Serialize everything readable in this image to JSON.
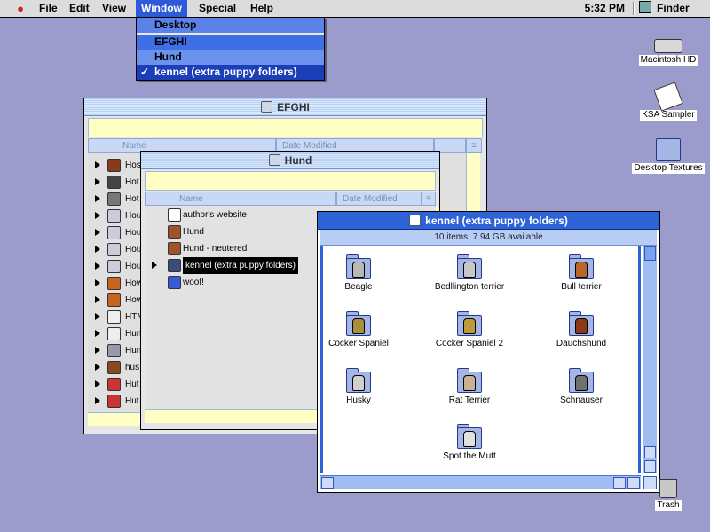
{
  "menubar": {
    "apple": "",
    "items": [
      "File",
      "Edit",
      "View",
      "Window",
      "Special",
      "Help"
    ],
    "clock": "5:32 PM",
    "app_name": "Finder"
  },
  "window_menu": {
    "items": [
      {
        "label": "Desktop",
        "checked": false
      },
      {
        "label": "EFGHI",
        "checked": false
      },
      {
        "label": "Hund",
        "checked": false
      },
      {
        "label": "kennel (extra puppy folders)",
        "checked": true
      }
    ]
  },
  "windows": {
    "efghi": {
      "title": "EFGHI",
      "col_name": "Name",
      "col_date": "Date Modified",
      "rows": [
        "Hos",
        "Hot",
        "Hot",
        "Hou",
        "Hou",
        "Hou",
        "Hou",
        "How",
        "How",
        "HTM",
        "Hun",
        "Hun",
        "hus",
        "Hut",
        "Hut"
      ]
    },
    "hund": {
      "title": "Hund",
      "col_name": "Name",
      "col_date": "Date Modified",
      "rows": [
        {
          "label": "author's website",
          "expandable": false
        },
        {
          "label": "Hund",
          "expandable": false
        },
        {
          "label": "Hund - neutered",
          "expandable": false
        },
        {
          "label": "kennel (extra puppy folders)",
          "expandable": true,
          "selected": true
        },
        {
          "label": "woof!",
          "expandable": false
        }
      ]
    },
    "kennel": {
      "title": "kennel (extra puppy folders)",
      "status": "10 items, 7.94 GB available",
      "items": [
        {
          "label": "Beagle",
          "dog_color": "#b8b8b8"
        },
        {
          "label": "Bedllington terrier",
          "dog_color": "#c8c8c8"
        },
        {
          "label": "Bull terrier",
          "dog_color": "#b8682a"
        },
        {
          "label": "Cocker Spaniel",
          "dog_color": "#a8903a"
        },
        {
          "label": "Cocker Spaniel 2",
          "dog_color": "#c09a38"
        },
        {
          "label": "Dauchshund",
          "dog_color": "#8a3a1a"
        },
        {
          "label": "Husky",
          "dog_color": "#d0d0d0"
        },
        {
          "label": "Rat Terrier",
          "dog_color": "#c8b090"
        },
        {
          "label": "Schnauser",
          "dog_color": "#707070"
        },
        {
          "label": "Spot the Mutt",
          "dog_color": "#e0e0e0"
        }
      ]
    }
  },
  "desktop_icons": [
    {
      "label": "Macintosh HD",
      "icon": "hard-drive-icon"
    },
    {
      "label": "KSA Sampler",
      "icon": "document-icon"
    },
    {
      "label": "Desktop Textures",
      "icon": "folder-icon"
    },
    {
      "label": "Trash",
      "icon": "trash-icon"
    }
  ],
  "colors": {
    "desktop": "#9c9ccc",
    "highlight": "#2c5ad8",
    "window_accent": "#2e63d8"
  }
}
